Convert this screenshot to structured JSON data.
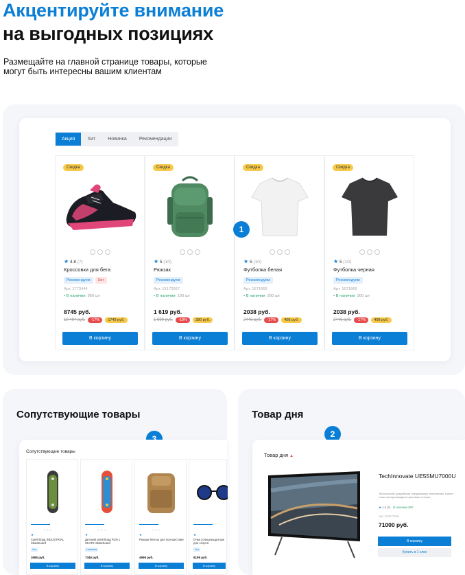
{
  "hero": {
    "title_line1": "Акцентируйте внимание",
    "title_line2": "на выгодных позициях",
    "subtitle": "Размещайте на главной странице товары, которые могут быть интересны вашим клиентам"
  },
  "tabs": [
    "Акция",
    "Хит",
    "Новинка",
    "Рекомендации"
  ],
  "products": [
    {
      "badge": "Скидка",
      "rating": "4.8",
      "reviews": "(7)",
      "name": "Кроссовки для бега",
      "tags": [
        "Рекомендуем",
        "Хит"
      ],
      "sku": "Арт. 1773444",
      "stock": "В наличии",
      "qty": "950 шт",
      "price": "8745 руб.",
      "old_price": "10 494 руб.",
      "discount": "-17%",
      "save": "1749 руб.",
      "button": "В корзину"
    },
    {
      "badge": "Скидка",
      "rating": "5",
      "reviews": "(10)",
      "name": "Рюкзак",
      "tags": [
        "Рекомендуем"
      ],
      "sku": "Арт. 15172667",
      "stock": "В наличии",
      "qty": "100 шт",
      "price": "1 619 руб.",
      "old_price": "1 999 руб.",
      "discount": "-19%",
      "save": "380 руб.",
      "button": "В корзину"
    },
    {
      "badge": "Скидка",
      "rating": "5",
      "reviews": "(10)",
      "name": "Футболка белая",
      "tags": [
        "Рекомендуем"
      ],
      "sku": "Арт. 1671866",
      "stock": "В наличии",
      "qty": "300 шт",
      "price": "2038 руб.",
      "old_price": "2446 руб.",
      "discount": "-17%",
      "save": "408 руб.",
      "button": "В корзину"
    },
    {
      "badge": "Скидка",
      "rating": "5",
      "reviews": "(10)",
      "name": "Футболка черная",
      "tags": [
        "Рекомендуем"
      ],
      "sku": "Арт. 1671866",
      "stock": "В наличии",
      "qty": "300 шт",
      "price": "2038 руб.",
      "old_price": "2446 руб.",
      "discount": "-17%",
      "save": "408 руб.",
      "button": "В корзину"
    }
  ],
  "markers": [
    "1",
    "2",
    "3"
  ],
  "related": {
    "section_title": "Сопутствующие товары",
    "widget_title": "Сопутствующие товары",
    "items": [
      {
        "name": "Скейтборд INDUSTRIAL Skateboard",
        "tag": "Хит",
        "price": "3685 руб.",
        "button": "В корзину"
      },
      {
        "name": "Детский скейтборд FUN 1 SKATE Skateboard",
        "tag": "Новинка",
        "price": "7345 руб.",
        "button": "В корзину"
      },
      {
        "name": "Рюкзак Remus для путешествия",
        "tag": "",
        "price": "4999 руб.",
        "button": "В корзину"
      },
      {
        "name": "Очки солнцезащитные для спорта",
        "tag": "Хит",
        "price": "8199 руб.",
        "button": "В корзину"
      }
    ]
  },
  "deal": {
    "section_title": "Товар дня",
    "widget_title": "Товар дня",
    "name": "TechInnovate UE55MU7000U",
    "description": "TechInnovate разработал специальную технологию. Более точно воспроизводить цветовые оттенки.",
    "rating": "4.8 (5)",
    "stock": "В наличии 350",
    "sku": "Арт. 2040-7016",
    "price": "71000 руб.",
    "cart_button": "В корзину",
    "one_click_button": "Купить в 1 клик"
  },
  "colors": {
    "accent": "#0b7fd6",
    "badge": "#f7c948",
    "discount": "#e84b4b",
    "stock": "#2aa36b"
  }
}
